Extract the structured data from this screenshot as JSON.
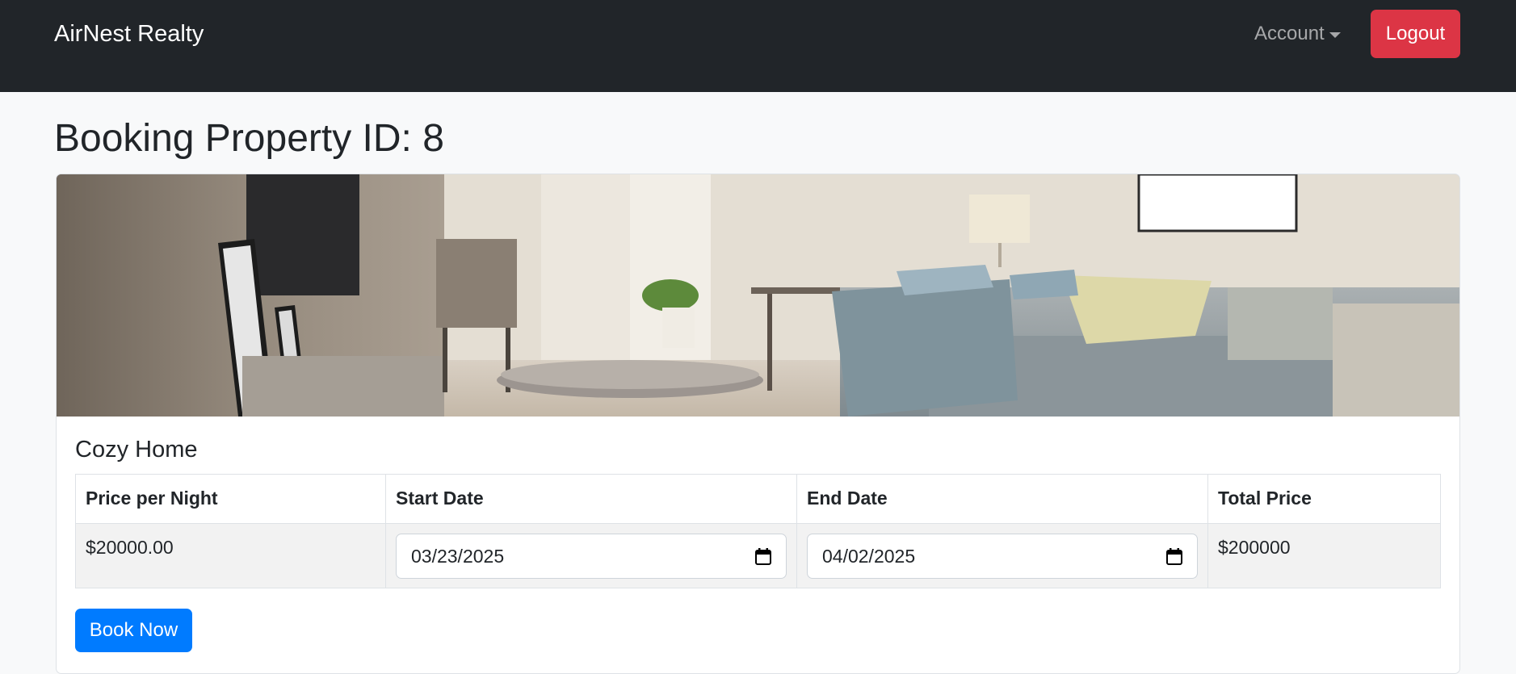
{
  "navbar": {
    "brand": "AirNest Realty",
    "account_label": "Account",
    "logout_label": "Logout"
  },
  "page": {
    "title": "Booking Property ID: 8"
  },
  "property": {
    "name": "Cozy Home",
    "image_icon": "living-room-photo"
  },
  "table": {
    "headers": [
      "Price per Night",
      "Start Date",
      "End Date",
      "Total Price"
    ],
    "price_per_night": "$20000.00",
    "start_date": "03/23/2025",
    "end_date": "04/02/2025",
    "total_price": "$200000"
  },
  "actions": {
    "book_label": "Book Now"
  },
  "colors": {
    "navbar_bg": "#212529",
    "logout_bg": "#dc3545",
    "primary": "#007bff",
    "page_bg": "#f8f9fa"
  }
}
